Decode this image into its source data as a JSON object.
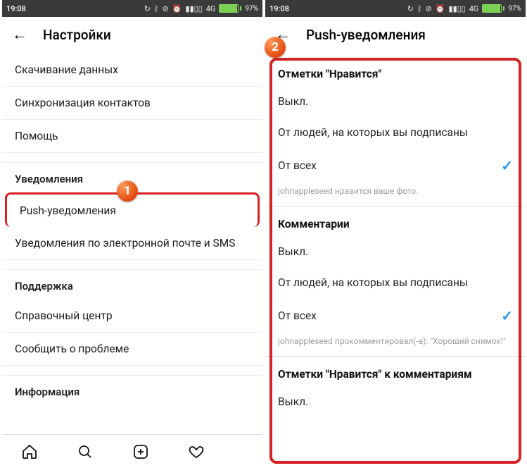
{
  "statusbar": {
    "time": "19:08",
    "network_label": "4G",
    "battery_pct": "97%"
  },
  "left": {
    "header_title": "Настройки",
    "items": {
      "download_data": "Скачивание данных",
      "sync_contacts": "Синхронизация контактов",
      "help": "Помощь"
    },
    "section_notifications": "Уведомления",
    "push_notifications": "Push-уведомления",
    "email_sms": "Уведомления по электронной почте и SMS",
    "section_support": "Поддержка",
    "help_center": "Справочный центр",
    "report_problem": "Сообщить о проблеме",
    "section_info": "Информация"
  },
  "right": {
    "header_title": "Push-уведомления",
    "group_likes": "Отметки \"Нравится\"",
    "opt_off": "Выкл.",
    "opt_following": "От людей, на которых вы подписаны",
    "opt_everyone": "От всех",
    "example_likes": "johnappleseed нравится ваше фото.",
    "group_comments": "Комментарии",
    "example_comments": "johnappleseed прокомментировал(-а): \"Хороший снимок!\"",
    "group_comment_likes": "Отметки \"Нравится\" к комментариям"
  },
  "badges": {
    "one": "1",
    "two": "2"
  }
}
